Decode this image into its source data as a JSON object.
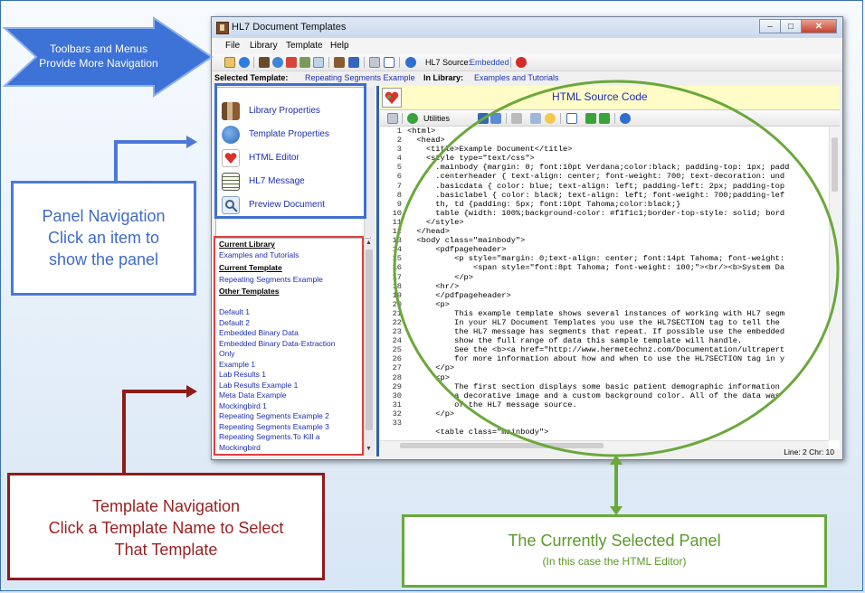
{
  "window": {
    "title": "HL7 Document Templates",
    "controls": [
      "–",
      "□",
      "✕"
    ]
  },
  "menu": [
    "File",
    "Library",
    "Template",
    "Help"
  ],
  "toolbar": {
    "source_label": "HL7 Source:",
    "source_value": "Embedded"
  },
  "selection": {
    "template_label": "Selected Template:",
    "template_value": "Repeating Segments Example",
    "library_label": "In Library:",
    "library_value": "Examples and Tutorials"
  },
  "panel_nav": {
    "items": [
      {
        "label": "Library Properties",
        "icon": "library-properties-icon"
      },
      {
        "label": "Template Properties",
        "icon": "template-properties-icon"
      },
      {
        "label": "HTML Editor",
        "icon": "html-editor-icon"
      },
      {
        "label": "HL7 Message",
        "icon": "hl7-message-icon"
      },
      {
        "label": "Preview Document",
        "icon": "preview-document-icon"
      }
    ]
  },
  "template_list": {
    "current_library_heading": "Current Library",
    "current_library": "Examples and Tutorials",
    "current_template_heading": "Current Template",
    "current_template": "Repeating Segments Example",
    "other_templates_heading": "Other Templates",
    "others": [
      "Default 1",
      "Default 2",
      "Embedded Binary Data",
      "Embedded Binary Data-Extraction",
      "Only",
      "Example 1",
      "Lab Results 1",
      "Lab Results Example 1",
      "Meta Data Example",
      "Mockingbird 1",
      "Repeating Segments Example 2",
      "Repeating Segments Example 3",
      "Repeating Segments.To Kill a",
      "Mockingbird"
    ]
  },
  "editor": {
    "title": "HTML Source Code",
    "utilities_label": "Utilities",
    "status": "Line: 2 Chr: 10",
    "line_numbers": [
      "1",
      "2",
      "3",
      "4",
      "5",
      "6",
      "7",
      "8",
      "9",
      "10",
      "11",
      "12",
      "13",
      "14",
      "15",
      "16",
      "17",
      "18",
      "19",
      "20",
      "21",
      "22",
      "23",
      "24",
      "25",
      "26",
      "27",
      "28",
      "29",
      "30",
      "31",
      "32",
      "33"
    ],
    "code_lines": [
      "<html>",
      "  <head>",
      "    <title>Example Document</title>",
      "    <style type=\"text/css\">",
      "      .mainbody {margin: 0; font:10pt Verdana;color:black; padding-top: 1px; padd",
      "      .centerheader { text-align: center; font-weight: 700; text-decoration: und",
      "      .basicdata { color: blue; text-align: left; padding-left: 2px; padding-top",
      "      .basiclabel { color: black; text-align: left; font-weight: 700;padding-lef",
      "      th, td {padding: 5px; font:10pt Tahoma;color:black;}",
      "      table {width: 100%;background-color: #f1f1c1;border-top-style: solid; bord",
      "    </style>",
      "  </head>",
      "  <body class=\"mainbody\">",
      "      <pdfpageheader>",
      "          <p style=\"margin: 0;text-align: center; font:14pt Tahoma; font-weight:",
      "              <span style=\"font:8pt Tahoma; font-weight: 100;\"><br/><b>System Da",
      "          </p>",
      "      <hr/>",
      "      </pdfpageheader>",
      "      <p>",
      "          This example template shows several instances of working with HL7 segm",
      "          In your HL7 Document Templates you use the HL7SECTION tag to tell the",
      "          the HL7 message has segments that repeat. If possible use the embedded",
      "          show the full range of data this sample template will handle.",
      "          See the <b><a href=\"http://www.hermetechnz.com/Documentation/ultrapert",
      "          for more information about how and when to use the HL7SECTION tag in y",
      "      </p>",
      "      <p>",
      "          The first section displays some basic patient demographic information",
      "          a decorative image and a custom background color. All of the data was",
      "          of the HL7 message source.",
      "      </p>",
      "",
      "      <table class=\"mainbody\">"
    ]
  },
  "annotations": {
    "toolbars_line1": "Toolbars and Menus",
    "toolbars_line2": "Provide More Navigation",
    "panel_nav_line1": "Panel Navigation",
    "panel_nav_line2": "Click an item to",
    "panel_nav_line3": "show the panel",
    "template_nav_line1": "Template Navigation",
    "template_nav_line2": "Click a Template Name to Select",
    "template_nav_line3": "That Template",
    "current_panel_line1": "The Currently Selected Panel",
    "current_panel_line2": "(In this case the HTML Editor)"
  },
  "colors": {
    "annotation_blue": "#3e6fd0",
    "annotation_red": "#8d1c1c",
    "annotation_green": "#6aa83b",
    "link_blue": "#1d2fb3",
    "editor_header": "#fffcc7"
  }
}
